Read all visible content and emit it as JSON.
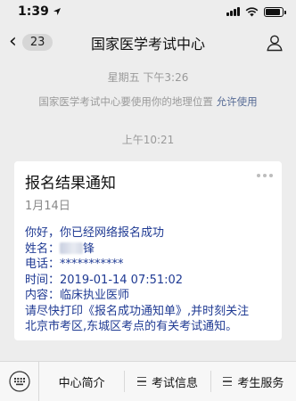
{
  "status_bar": {
    "time": "1:39",
    "icons": [
      "location-arrow-icon",
      "signal-icon",
      "wifi-icon",
      "battery-icon"
    ],
    "battery_level": 0.9
  },
  "nav": {
    "unread_count": "23",
    "title": "国家医学考试中心",
    "icons": [
      "back-chevron-icon",
      "profile-icon"
    ]
  },
  "conversation": {
    "timestamp_1": "星期五 下午3:26",
    "system_message": "国家医学考试中心要使用你的地理位置",
    "system_link": "允许使用",
    "timestamp_2": "上午10:21",
    "card": {
      "title": "报名结果通知",
      "date": "1月14日",
      "lines": {
        "greeting": "你好，你已经网络报名成功",
        "name_prefix": "姓名：",
        "name_visible": "锋",
        "phone": "电话：***********",
        "time": "时间：2019-01-14 07:51:02",
        "content": "内容：临床执业医师",
        "notice_1": "请尽快打印《报名成功通知单》,并时刻关注",
        "notice_2": "北京市考区,东城区考点的有关考试通知。"
      }
    }
  },
  "tab_bar": {
    "items": [
      "中心简介",
      "考试信息",
      "考生服务"
    ],
    "icons": [
      "keyboard-icon",
      "menu-icon"
    ]
  },
  "colors": {
    "background": "#ededed",
    "card_text": "#1f3a93",
    "link": "#576b95",
    "muted": "#9a9a9a"
  }
}
